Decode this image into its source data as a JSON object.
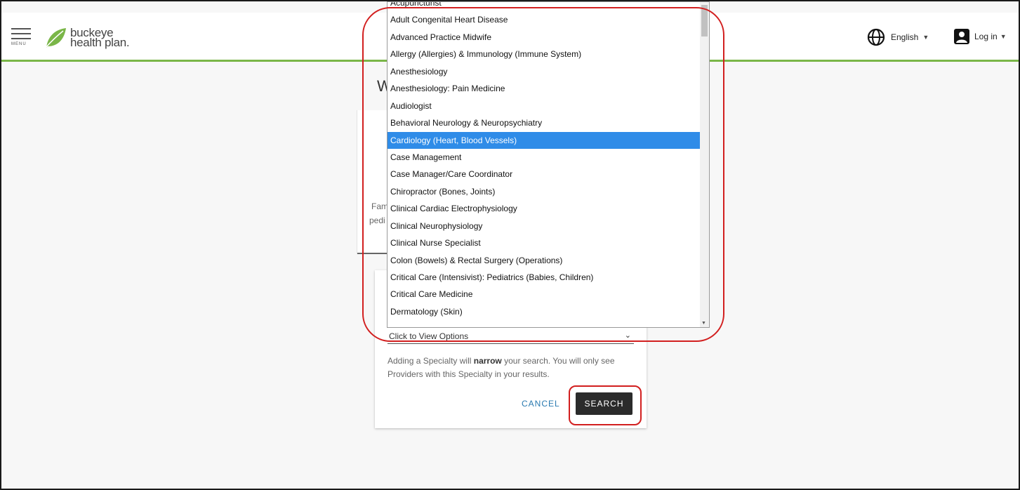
{
  "header": {
    "menu_label": "MENU",
    "logo_line1": "buckeye",
    "logo_line2": "health plan.",
    "language_label": "English",
    "login_label": "Log in"
  },
  "background": {
    "heading_initial": "W",
    "text_fragment_1": "Fam",
    "text_fragment_2": "pedi"
  },
  "dialog": {
    "select_placeholder": "Click to View Options",
    "help_text_before": "Adding a Specialty will",
    "help_text_bold": "narrow",
    "help_text_after": "your search. You will only see Providers with this Specialty in your results.",
    "cancel_label": "CANCEL",
    "search_label": "SEARCH"
  },
  "dropdown": {
    "selected_index": 8,
    "options": [
      "Acupuncturist",
      "Adult Congenital Heart Disease",
      "Advanced Practice Midwife",
      "Allergy (Allergies) & Immunology (Immune System)",
      "Anesthesiology",
      "Anesthesiology: Pain Medicine",
      "Audiologist",
      "Behavioral Neurology & Neuropsychiatry",
      "Cardiology (Heart, Blood Vessels)",
      "Case Management",
      "Case Manager/Care Coordinator",
      "Chiropractor (Bones, Joints)",
      "Clinical Cardiac Electrophysiology",
      "Clinical Neurophysiology",
      "Clinical Nurse Specialist",
      "Colon (Bowels) & Rectal Surgery (Operations)",
      "Critical Care (Intensivist): Pediatrics (Babies, Children)",
      "Critical Care Medicine",
      "Dermatology (Skin)"
    ]
  },
  "colors": {
    "brand_green": "#7ab648",
    "selected_blue": "#2f8ce8",
    "annotation_red": "#d21f1f",
    "link_blue": "#2a7ab0"
  }
}
